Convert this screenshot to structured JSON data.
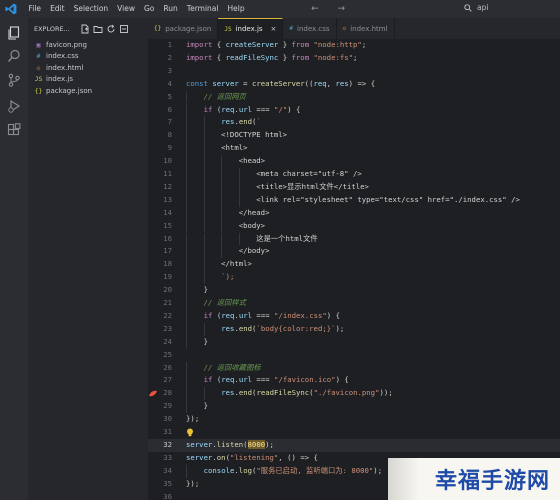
{
  "menu": [
    "File",
    "Edit",
    "Selection",
    "View",
    "Go",
    "Run",
    "Terminal",
    "Help"
  ],
  "nav_arrows": "← →",
  "search": {
    "label": "api"
  },
  "sidebar": {
    "title": "EXPLORE...",
    "files": [
      {
        "name": "favicon.png",
        "icon": "▣",
        "color": "#b07acb"
      },
      {
        "name": "index.css",
        "icon": "#",
        "color": "#519aba"
      },
      {
        "name": "index.html",
        "icon": "◇",
        "color": "#e37933"
      },
      {
        "name": "index.js",
        "icon": "JS",
        "color": "#cbcb41"
      },
      {
        "name": "package.json",
        "icon": "{}",
        "color": "#cbcb41"
      }
    ]
  },
  "tabs": [
    {
      "label": "package.json",
      "icon": "{}",
      "color": "#cbcb41",
      "active": false
    },
    {
      "label": "index.js",
      "icon": "JS",
      "color": "#cbcb41",
      "active": true,
      "close": "×"
    },
    {
      "label": "index.css",
      "icon": "#",
      "color": "#519aba",
      "active": false
    },
    {
      "label": "index.html",
      "icon": "◇",
      "color": "#e37933",
      "active": false
    }
  ],
  "code_lines": [
    {
      "n": "1",
      "code": "import { createServer } from \"node:http\";"
    },
    {
      "n": "2",
      "code": "import { readFileSync } from \"node:fs\";"
    },
    {
      "n": "3",
      "code": ""
    },
    {
      "n": "4",
      "code": "const server = createServer((req, res) => {"
    },
    {
      "n": "5",
      "code": "    // 返回网页"
    },
    {
      "n": "6",
      "code": "    if (req.url === \"/\") {"
    },
    {
      "n": "7",
      "code": "        res.end(`"
    },
    {
      "n": "8",
      "code": "        <!DOCTYPE html>"
    },
    {
      "n": "9",
      "code": "        <html>"
    },
    {
      "n": "10",
      "code": "            <head>"
    },
    {
      "n": "11",
      "code": "                <meta charset=\"utf-8\" />"
    },
    {
      "n": "12",
      "code": "                <title>显示html文件</title>"
    },
    {
      "n": "13",
      "code": "                <link rel=\"stylesheet\" type=\"text/css\" href=\"./index.css\" />"
    },
    {
      "n": "14",
      "code": "            </head>"
    },
    {
      "n": "15",
      "code": "            <body>"
    },
    {
      "n": "16",
      "code": "                这是一个html文件"
    },
    {
      "n": "17",
      "code": "            </body>"
    },
    {
      "n": "18",
      "code": "        </html>"
    },
    {
      "n": "19",
      "code": "        `);"
    },
    {
      "n": "20",
      "code": "    }"
    },
    {
      "n": "21",
      "code": "    // 返回样式"
    },
    {
      "n": "22",
      "code": "    if (req.url === \"/index.css\") {"
    },
    {
      "n": "23",
      "code": "        res.end(`body{color:red;}`);"
    },
    {
      "n": "24",
      "code": "    }"
    },
    {
      "n": "25",
      "code": ""
    },
    {
      "n": "26",
      "code": "    // 返回收藏图标"
    },
    {
      "n": "27",
      "code": "    if (req.url === \"/favicon.ico\") {"
    },
    {
      "n": "28",
      "code": "        res.end(readFileSync(\"./favicon.png\"));"
    },
    {
      "n": "29",
      "code": "    }"
    },
    {
      "n": "30",
      "code": "});"
    },
    {
      "n": "31",
      "code": ""
    },
    {
      "n": "32",
      "code": "server.listen(8000);"
    },
    {
      "n": "33",
      "code": "server.on(\"listening\", () => {"
    },
    {
      "n": "34",
      "code": "    console.log(\"服务已启动, 监听端口为: 8000\");"
    },
    {
      "n": "35",
      "code": "});"
    },
    {
      "n": "36",
      "code": ""
    }
  ],
  "watermark": {
    "text": "幸福手游网"
  },
  "colors": {
    "accent_tab": "#d6b43a",
    "breakpoint": "#e5533d"
  }
}
